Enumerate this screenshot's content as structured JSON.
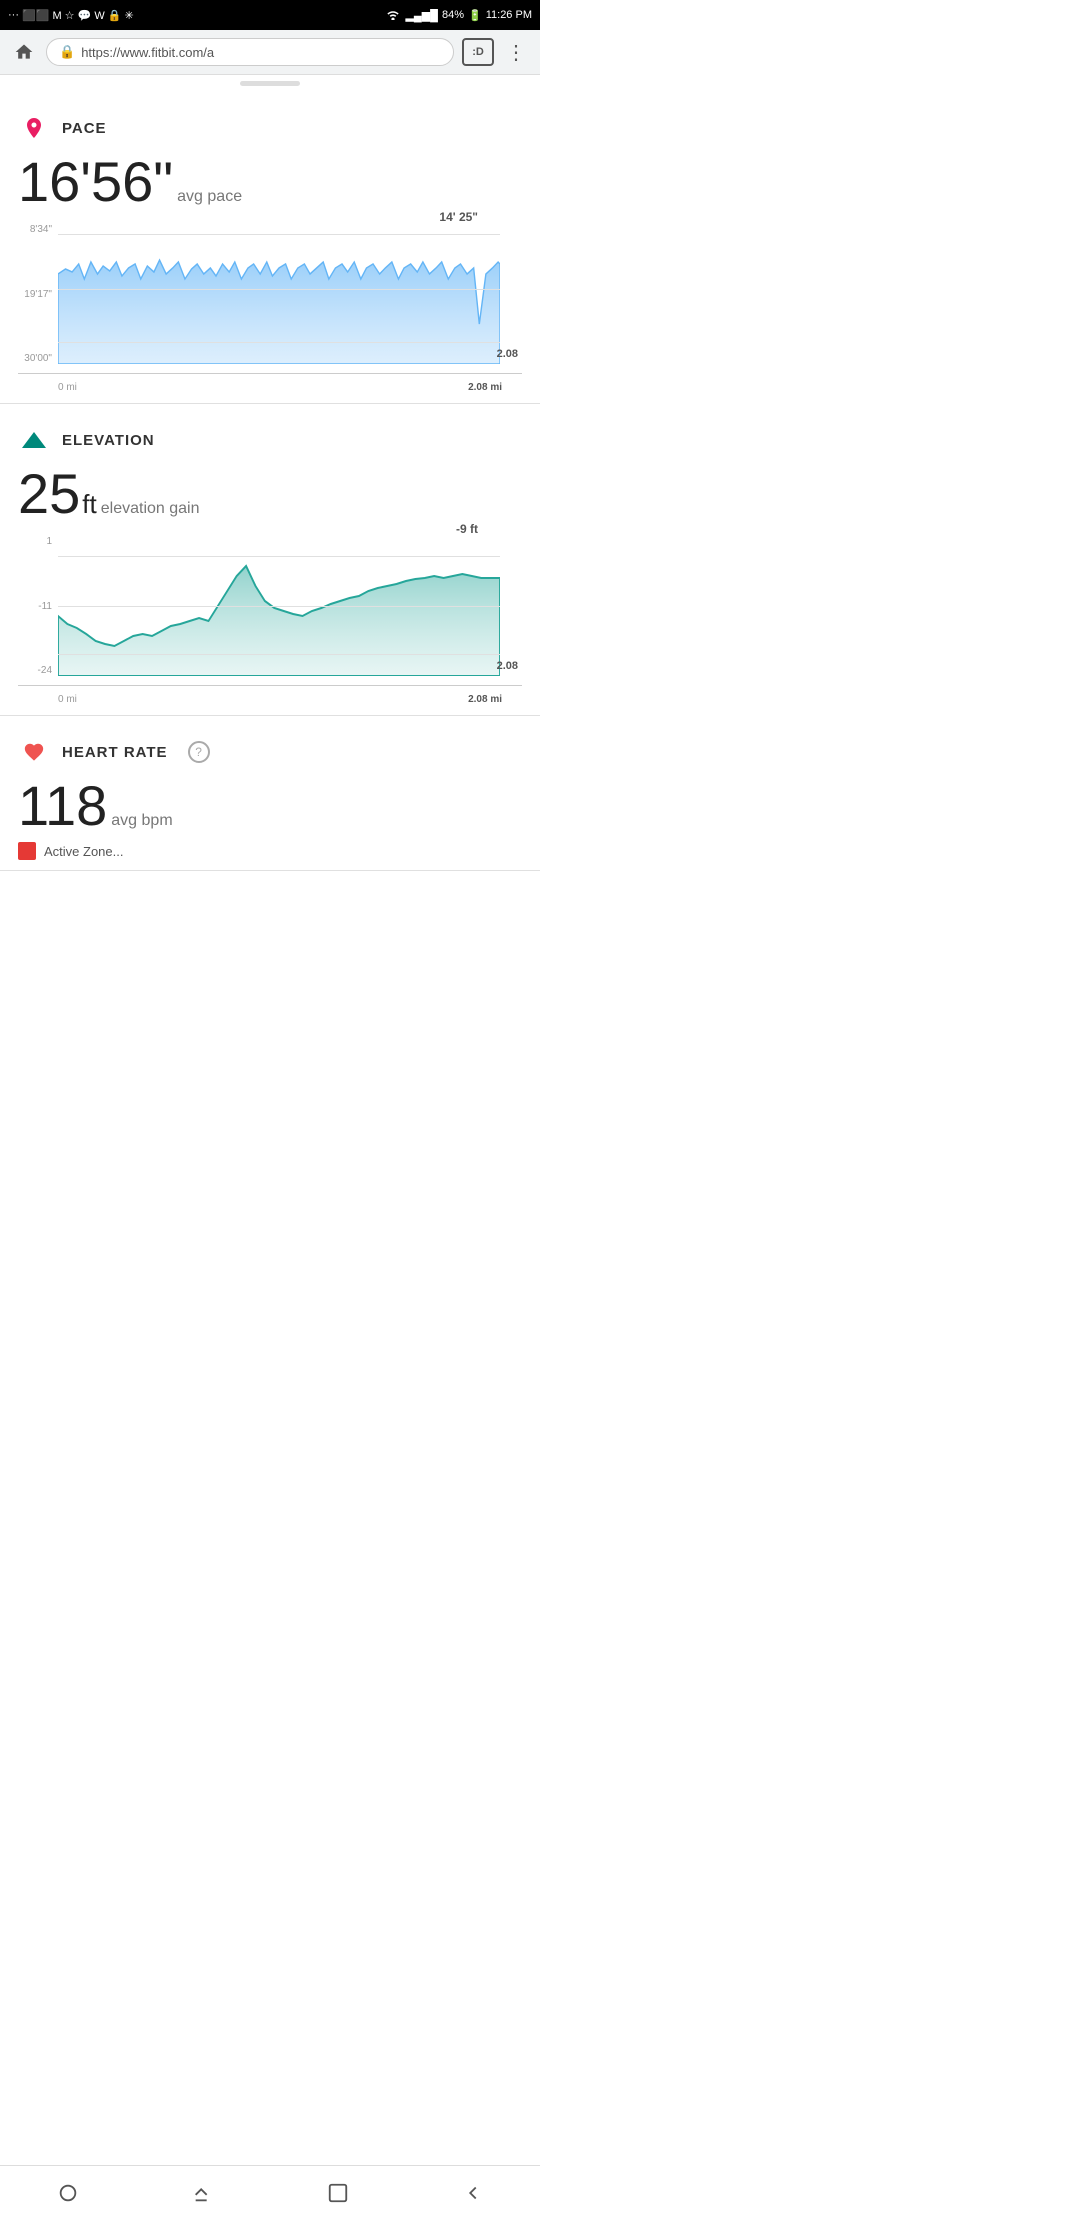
{
  "statusBar": {
    "left": "···  ⬛  ⬛  M  🏆  💬  W  🔒  ✳",
    "battery": "84%",
    "time": "11:26 PM",
    "signal": "▂▄▆█"
  },
  "browser": {
    "url": "https://www.fitbit.com/a",
    "urlPrefix": "https://",
    "urlDomain": "www.fitbit.com/a",
    "tabLabel": ":D"
  },
  "pace": {
    "sectionTitle": "PACE",
    "value": "16'56\"",
    "valueFeet": "16'",
    "valueSeconds": "56\"",
    "unitLabel": "avg pace",
    "chart": {
      "topLabel": "14' 25\"",
      "yLabels": [
        "8'34\"",
        "19'17\"",
        "30'00\""
      ],
      "xLabelLeft": "0 mi",
      "xLabelRight": "2.08 mi",
      "xValue": "2.08"
    }
  },
  "elevation": {
    "sectionTitle": "ELEVATION",
    "value": "25",
    "unitLabel": "ft",
    "subLabel": "elevation gain",
    "chart": {
      "topLabel": "-9 ft",
      "yLabels": [
        "1",
        "-11",
        "-24"
      ],
      "xLabelLeft": "0 mi",
      "xLabelRight": "2.08 mi",
      "xValue": "2.08"
    }
  },
  "heartRate": {
    "sectionTitle": "HEART RATE",
    "value": "118",
    "unitLabel": "avg bpm",
    "hasInfo": true,
    "partialLabel": "Active Zone..."
  },
  "bottomNav": {
    "items": [
      "circle",
      "corner-up-right",
      "square",
      "arrow-left"
    ]
  }
}
